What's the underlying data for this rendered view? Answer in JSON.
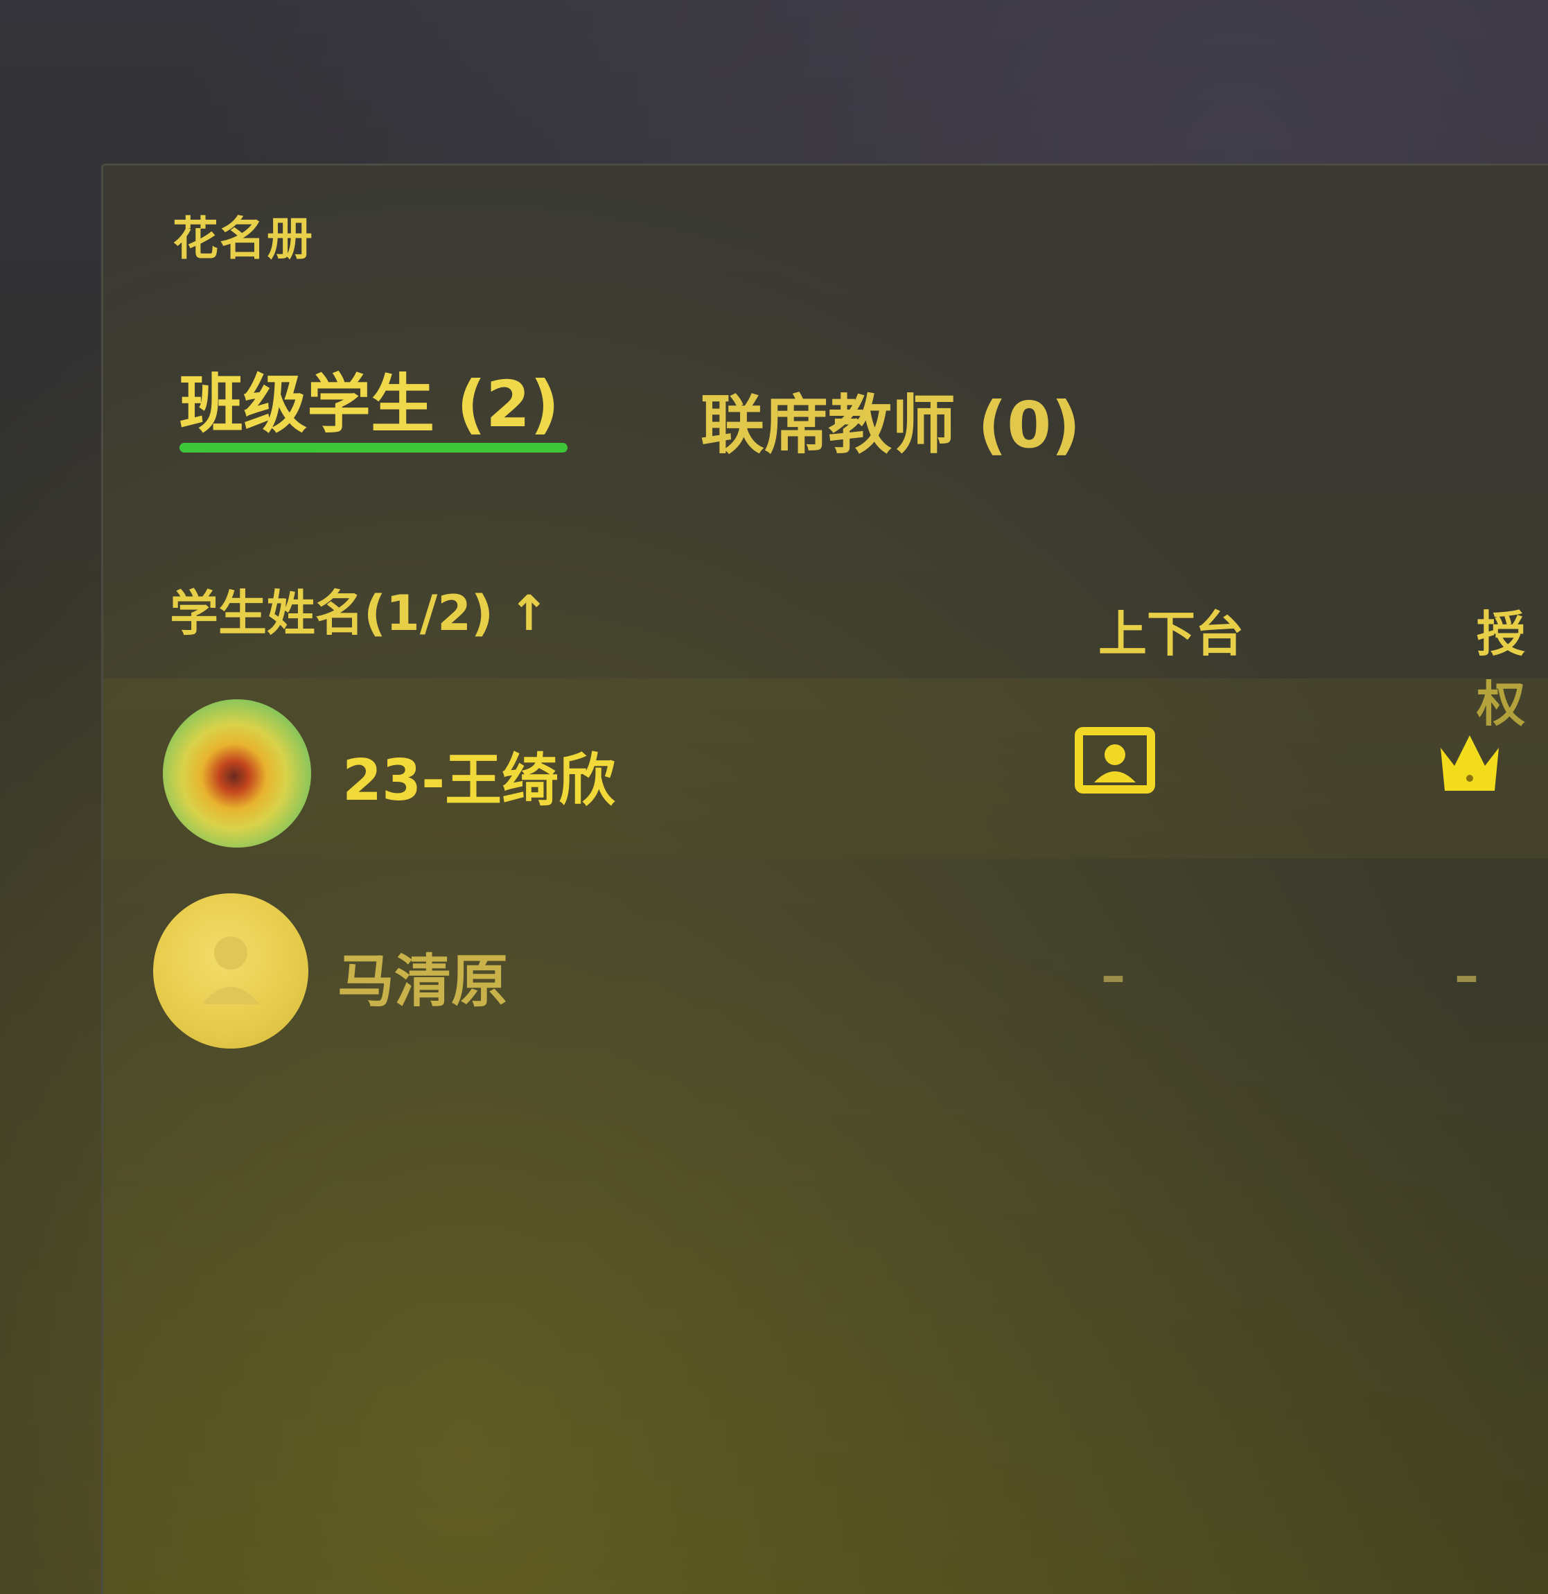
{
  "panel": {
    "title": "花名册"
  },
  "tabs": [
    {
      "label": "班级学生 (2)",
      "active": true
    },
    {
      "label": "联席教师 (0)",
      "active": false
    }
  ],
  "table": {
    "columns": {
      "name": "学生姓名(1/2)",
      "sort_icon": "arrow-up-icon",
      "stage": "上下台",
      "auth": "授权"
    },
    "rows": [
      {
        "name": "23-王绮欣",
        "stage_icon": "on-stage-person-icon",
        "auth_icon": "crown-icon"
      },
      {
        "name": "马清原",
        "stage_value": "–",
        "auth_value": "–"
      }
    ]
  },
  "colors": {
    "accent_text": "#efd84a",
    "tab_indicator": "#3fc73a",
    "panel_bg": "#3a3934"
  }
}
